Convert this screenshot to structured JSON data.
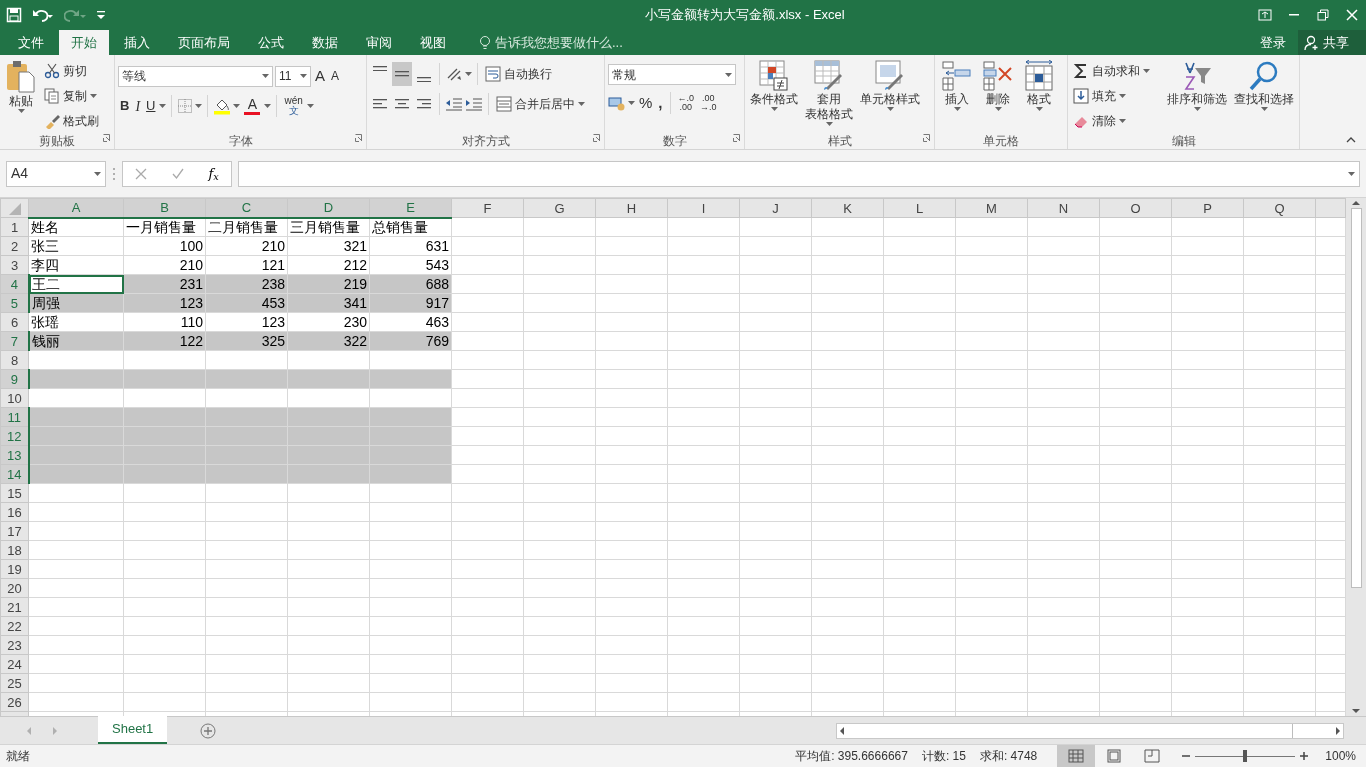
{
  "window": {
    "title": "小写金额转为大写金额.xlsx - Excel"
  },
  "ribbon_tabs": [
    {
      "label": "文件",
      "selected": false
    },
    {
      "label": "开始",
      "selected": true
    },
    {
      "label": "插入",
      "selected": false
    },
    {
      "label": "页面布局",
      "selected": false
    },
    {
      "label": "公式",
      "selected": false
    },
    {
      "label": "数据",
      "selected": false
    },
    {
      "label": "审阅",
      "selected": false
    },
    {
      "label": "视图",
      "selected": false
    }
  ],
  "tell_me": {
    "placeholder": "告诉我您想要做什么..."
  },
  "account": {
    "sign_in": "登录",
    "share": "共享"
  },
  "ribbon_groups": [
    {
      "kind": "clipboard",
      "label": "剪贴板",
      "paste": "粘贴",
      "commands": [
        "剪切",
        "复制",
        "格式刷"
      ]
    },
    {
      "kind": "font",
      "label": "字体",
      "font_name": "等线",
      "font_size": "11",
      "grow": "A",
      "shrink": "A",
      "bold": "B",
      "italic": "I",
      "underline": "U",
      "font_color": "A",
      "phonetic_top": "wén",
      "phonetic_bottom": "文"
    },
    {
      "kind": "alignment",
      "label": "对齐方式",
      "wrap": "自动换行",
      "merge": "合并后居中"
    },
    {
      "kind": "number",
      "label": "数字",
      "format": "常规",
      "percent": "%",
      "comma": ",",
      "decimals": [
        {
          "top": "←.0",
          "bottom": ".00"
        },
        {
          "top": ".00",
          "bottom": "→.0"
        }
      ]
    },
    {
      "kind": "styles",
      "label": "样式",
      "commands": [
        {
          "label": "条件格式"
        },
        {
          "label": "套用",
          "label_2": "表格格式"
        },
        {
          "label": "单元格样式"
        }
      ]
    },
    {
      "kind": "cells",
      "label": "单元格",
      "commands": [
        "插入",
        "删除",
        "格式"
      ]
    },
    {
      "kind": "editing",
      "label": "编辑",
      "small": [
        "自动求和",
        "填充",
        "清除"
      ],
      "large": [
        "排序和筛选",
        "查找和选择"
      ]
    }
  ],
  "name_box": {
    "value": "A4"
  },
  "formula_bar": {
    "function_label": "f$_{x}$"
  },
  "columns": [
    {
      "letter": "A",
      "selected": true
    },
    {
      "letter": "B",
      "selected": true
    },
    {
      "letter": "C",
      "selected": true
    },
    {
      "letter": "D",
      "selected": true
    },
    {
      "letter": "E",
      "selected": true
    },
    {
      "letter": "F",
      "selected": false
    },
    {
      "letter": "G",
      "selected": false
    },
    {
      "letter": "H",
      "selected": false
    },
    {
      "letter": "I",
      "selected": false
    },
    {
      "letter": "J",
      "selected": false
    },
    {
      "letter": "K",
      "selected": false
    },
    {
      "letter": "L",
      "selected": false
    },
    {
      "letter": "M",
      "selected": false
    },
    {
      "letter": "N",
      "selected": false
    },
    {
      "letter": "O",
      "selected": false
    },
    {
      "letter": "P",
      "selected": false
    },
    {
      "letter": "Q",
      "selected": false
    }
  ],
  "rows": [
    {
      "number": "1",
      "selected": false,
      "cells": [
        {
          "text": "姓名",
          "kind": "text",
          "active": false
        },
        {
          "text": "一月销售量",
          "kind": "text",
          "active": false
        },
        {
          "text": "二月销售量",
          "kind": "text",
          "active": false
        },
        {
          "text": "三月销售量",
          "kind": "text",
          "active": false
        },
        {
          "text": "总销售量",
          "kind": "text",
          "active": false
        }
      ]
    },
    {
      "number": "2",
      "selected": false,
      "cells": [
        {
          "text": "张三",
          "kind": "text",
          "active": false
        },
        {
          "text": "100",
          "kind": "number",
          "active": false
        },
        {
          "text": "210",
          "kind": "number",
          "active": false
        },
        {
          "text": "321",
          "kind": "number",
          "active": false
        },
        {
          "text": "631",
          "kind": "number",
          "active": false
        }
      ]
    },
    {
      "number": "3",
      "selected": false,
      "cells": [
        {
          "text": "李四",
          "kind": "text",
          "active": false
        },
        {
          "text": "210",
          "kind": "number",
          "active": false
        },
        {
          "text": "121",
          "kind": "number",
          "active": false
        },
        {
          "text": "212",
          "kind": "number",
          "active": false
        },
        {
          "text": "543",
          "kind": "number",
          "active": false
        }
      ]
    },
    {
      "number": "4",
      "selected": true,
      "cells": [
        {
          "text": "王二",
          "kind": "text",
          "active": true
        },
        {
          "text": "231",
          "kind": "number",
          "active": false
        },
        {
          "text": "238",
          "kind": "number",
          "active": false
        },
        {
          "text": "219",
          "kind": "number",
          "active": false
        },
        {
          "text": "688",
          "kind": "number",
          "active": false
        }
      ]
    },
    {
      "number": "5",
      "selected": true,
      "cells": [
        {
          "text": "周强",
          "kind": "text",
          "active": false
        },
        {
          "text": "123",
          "kind": "number",
          "active": false
        },
        {
          "text": "453",
          "kind": "number",
          "active": false
        },
        {
          "text": "341",
          "kind": "number",
          "active": false
        },
        {
          "text": "917",
          "kind": "number",
          "active": false
        }
      ]
    },
    {
      "number": "6",
      "selected": false,
      "cells": [
        {
          "text": "张瑶",
          "kind": "text",
          "active": false
        },
        {
          "text": "110",
          "kind": "number",
          "active": false
        },
        {
          "text": "123",
          "kind": "number",
          "active": false
        },
        {
          "text": "230",
          "kind": "number",
          "active": false
        },
        {
          "text": "463",
          "kind": "number",
          "active": false
        }
      ]
    },
    {
      "number": "7",
      "selected": true,
      "cells": [
        {
          "text": "钱丽",
          "kind": "text",
          "active": false
        },
        {
          "text": "122",
          "kind": "number",
          "active": false
        },
        {
          "text": "325",
          "kind": "number",
          "active": false
        },
        {
          "text": "322",
          "kind": "number",
          "active": false
        },
        {
          "text": "769",
          "kind": "number",
          "active": false
        }
      ]
    },
    {
      "number": "8",
      "selected": false,
      "cells": []
    },
    {
      "number": "9",
      "selected": true,
      "cells": []
    },
    {
      "number": "10",
      "selected": false,
      "cells": []
    },
    {
      "number": "11",
      "selected": true,
      "cells": []
    },
    {
      "number": "12",
      "selected": true,
      "cells": []
    },
    {
      "number": "13",
      "selected": true,
      "cells": []
    },
    {
      "number": "14",
      "selected": true,
      "cells": []
    },
    {
      "number": "15",
      "selected": false,
      "cells": []
    },
    {
      "number": "16",
      "selected": false,
      "cells": []
    },
    {
      "number": "17",
      "selected": false,
      "cells": []
    },
    {
      "number": "18",
      "selected": false,
      "cells": []
    },
    {
      "number": "19",
      "selected": false,
      "cells": []
    },
    {
      "number": "20",
      "selected": false,
      "cells": []
    },
    {
      "number": "21",
      "selected": false,
      "cells": []
    },
    {
      "number": "22",
      "selected": false,
      "cells": []
    },
    {
      "number": "23",
      "selected": false,
      "cells": []
    },
    {
      "number": "24",
      "selected": false,
      "cells": []
    },
    {
      "number": "25",
      "selected": false,
      "cells": []
    },
    {
      "number": "26",
      "selected": false,
      "cells": []
    }
  ],
  "sheet_tabs": [
    {
      "label": "Sheet1",
      "selected": true
    }
  ],
  "status_bar": {
    "state": "就绪",
    "stats": [
      "平均值: 395.6666667",
      "计数: 15",
      "求和: 4748"
    ],
    "views": [
      {
        "kind": "normal",
        "selected": true
      },
      {
        "kind": "page_layout",
        "selected": false
      },
      {
        "kind": "page_break",
        "selected": false
      }
    ],
    "zoom": {
      "level": 0.5,
      "reading": "100%"
    }
  }
}
